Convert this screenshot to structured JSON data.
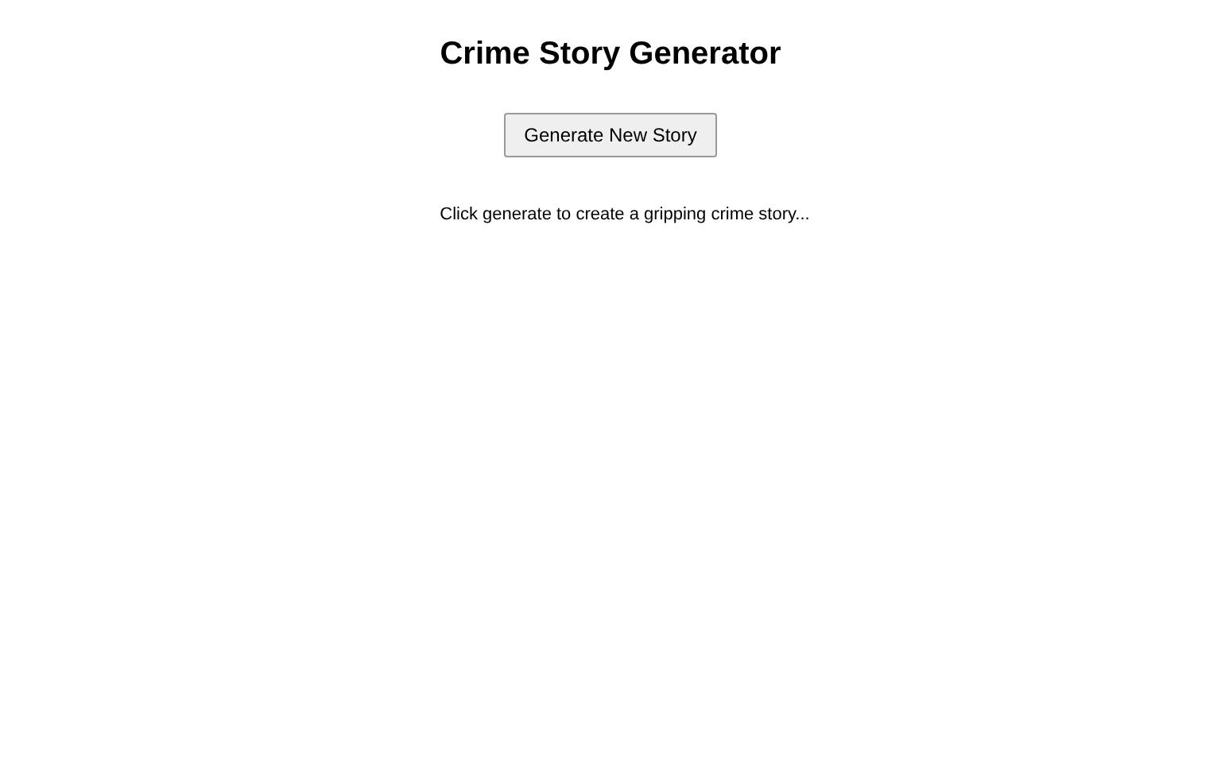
{
  "title": "Crime Story Generator",
  "button": {
    "label": "Generate New Story"
  },
  "story": {
    "placeholder_text": "Click generate to create a gripping crime story..."
  }
}
